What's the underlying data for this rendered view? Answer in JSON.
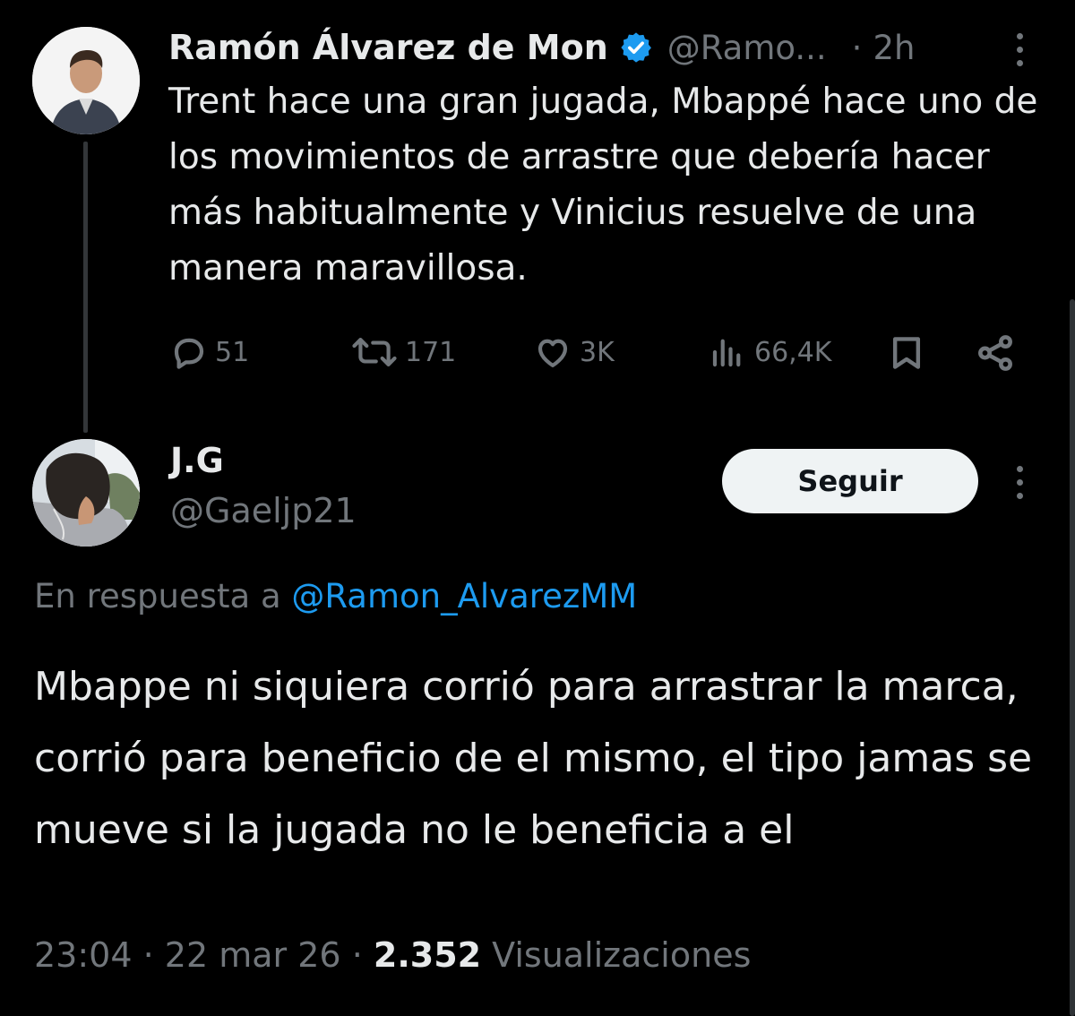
{
  "original_tweet": {
    "author_name": "Ramón Álvarez de Mon",
    "handle": "@Ramo...",
    "separator": "·",
    "time": "2h",
    "text": "Trent hace una gran jugada, Mbappé hace uno de los movimientos de arrastre que debería hacer más habitualmente y Vinicius resuelve de una manera maravillosa.",
    "actions": {
      "replies": "51",
      "reposts": "171",
      "likes": "3K",
      "views": "66,4K"
    },
    "icons": [
      "verified-badge-icon",
      "reply-icon",
      "repost-icon",
      "like-icon",
      "views-icon",
      "bookmark-icon",
      "share-icon",
      "more-options-icon"
    ]
  },
  "reply_tweet": {
    "author_name": "J.G",
    "handle": "@Gaeljp21",
    "follow_label": "Seguir",
    "reply_prefix": "En respuesta a",
    "reply_to": "@Ramon_AlvarezMM",
    "text": "Mbappe ni siquiera corrió para arrastrar la marca, corrió para beneficio de el mismo, el tipo jamas se mueve si la jugada no le beneficia a el",
    "time": "23:04",
    "date": "22 mar 26",
    "dot": "·",
    "views_count": "2.352",
    "views_label": "Visualizaciones"
  },
  "colors": {
    "background": "#000000",
    "text": "#e7e9ea",
    "muted": "#71767b",
    "link": "#1d9bf0",
    "verified": "#1d9bf0"
  }
}
